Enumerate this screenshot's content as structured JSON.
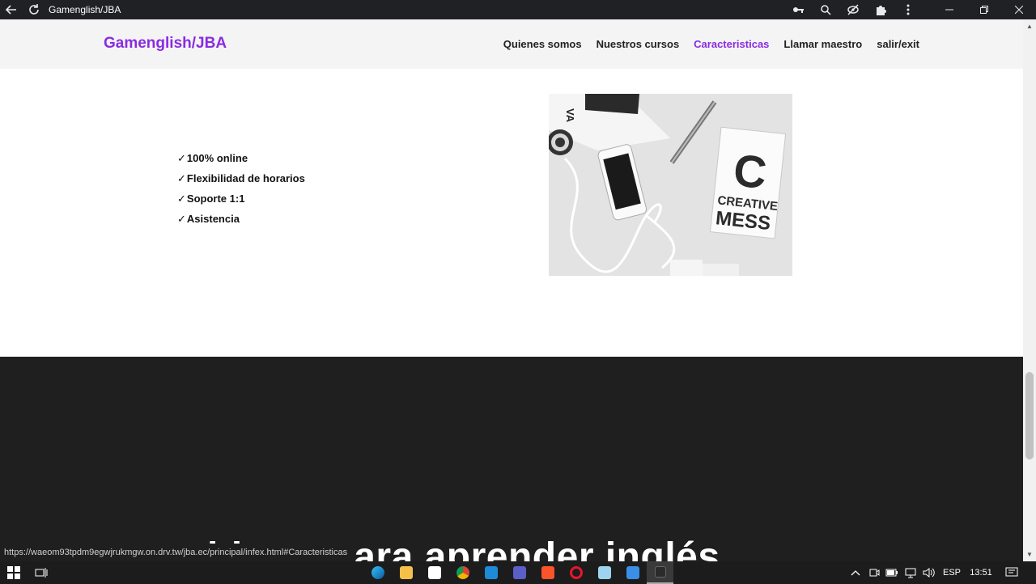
{
  "browser": {
    "title": "Gamenglish/JBA",
    "back_icon": "arrow-left-icon",
    "reload_icon": "reload-icon"
  },
  "navbar": {
    "brand": "Gamenglish/JBA",
    "links": [
      {
        "label": "Quienes somos",
        "active": false
      },
      {
        "label": "Nuestros cursos",
        "active": false
      },
      {
        "label": "Caracteristicas",
        "active": true
      },
      {
        "label": "Llamar maestro",
        "active": false
      },
      {
        "label": "salir/exit",
        "active": false
      }
    ]
  },
  "features": {
    "check_mark": "✓",
    "items": [
      "100% online",
      "Flexibilidad de horarios",
      "Soporte 1:1",
      "Asistencia"
    ]
  },
  "photo": {
    "label_c": "C",
    "label_line1": "CREATIVE",
    "label_line2": "MESS",
    "corner_text": "VA"
  },
  "dark_section": {
    "heading_partial": "ara aprender inglés",
    "heading_left_partial": "bict"
  },
  "status_bar": {
    "url": "https://waeom93tpdm9egwjrukmgw.on.drv.tw/jba.ec/principal/infex.html#Caracteristicas"
  },
  "taskbar": {
    "language": "ESP",
    "time": "13:51"
  },
  "colors": {
    "accent": "#8a2be2",
    "dark_bg": "#1f1f1f",
    "nav_bg": "#f4f4f4"
  }
}
